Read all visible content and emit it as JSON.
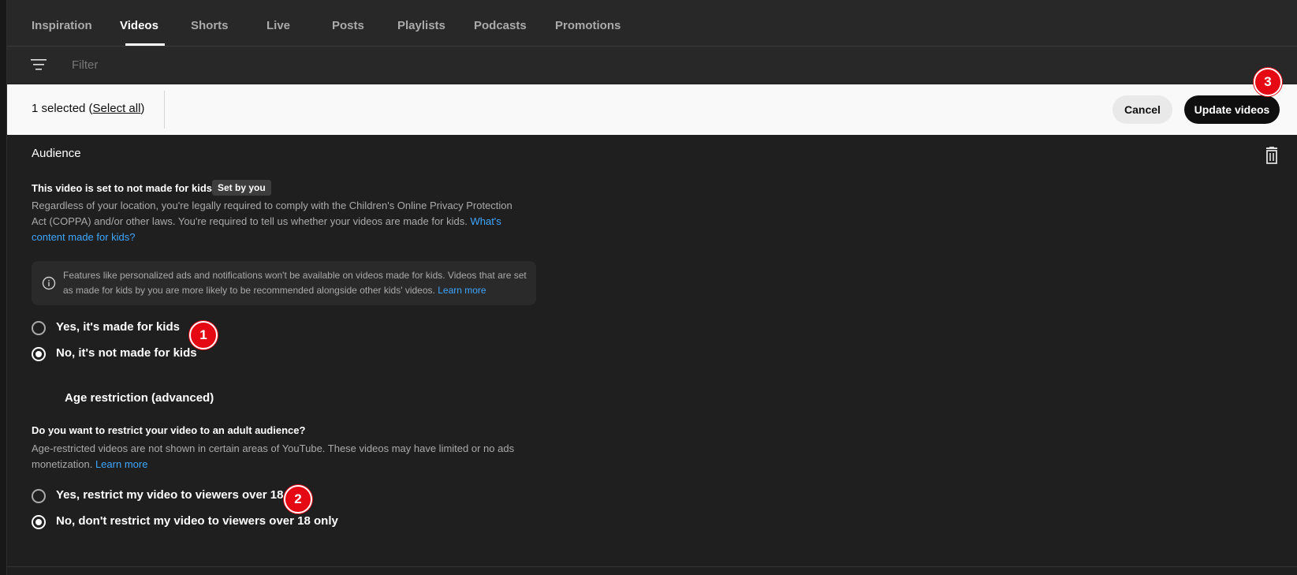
{
  "tabs": [
    {
      "label": "Inspiration"
    },
    {
      "label": "Videos",
      "active": true
    },
    {
      "label": "Shorts"
    },
    {
      "label": "Live"
    },
    {
      "label": "Posts"
    },
    {
      "label": "Playlists"
    },
    {
      "label": "Podcasts"
    },
    {
      "label": "Promotions"
    }
  ],
  "filter": {
    "placeholder": "Filter",
    "icon": "filter-icon"
  },
  "selection": {
    "count_text": "1 selected (",
    "select_all": "Select all",
    "close_paren": ")",
    "cancel_label": "Cancel",
    "update_label": "Update videos"
  },
  "audience": {
    "title": "Audience",
    "delete_icon": "trash-icon",
    "kids_title": "This video is set to not made for kids",
    "kids_chip": "Set by you",
    "kids_desc": "Regardless of your location, you're legally required to comply with the Children's Online Privacy Protection Act (COPPA) and/or other laws. You're required to tell us whether your videos are made for kids.",
    "kids_link": "What's content made for kids?",
    "info_text": "Features like personalized ads and notifications won't be available on videos made for kids. Videos that are set as made for kids by you are more likely to be recommended alongside other kids' videos.",
    "info_link": "Learn more",
    "options": [
      {
        "label": "Yes, it's made for kids",
        "selected": false
      },
      {
        "label": "No, it's not made for kids",
        "selected": true
      }
    ]
  },
  "age": {
    "section_label": "Age restriction (advanced)",
    "question": "Do you want to restrict your video to an adult audience?",
    "desc": "Age-restricted videos are not shown in certain areas of YouTube. These videos may have limited or no ads monetization.",
    "link": "Learn more",
    "options": [
      {
        "label": "Yes, restrict my video to viewers over 18",
        "selected": false
      },
      {
        "label": "No, don't restrict my video to viewers over 18 only",
        "selected": true
      }
    ]
  },
  "markers": [
    "1",
    "2",
    "3"
  ],
  "colors": {
    "accent_link": "#3ea6ff",
    "marker": "#e50914",
    "background": "#1f1f1f"
  }
}
